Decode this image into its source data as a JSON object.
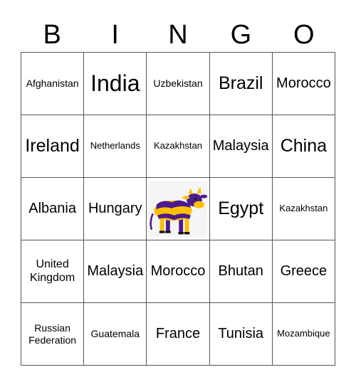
{
  "header": {
    "letters": [
      "B",
      "I",
      "N",
      "G",
      "O"
    ]
  },
  "grid": {
    "rows": [
      [
        {
          "text": "Afghanistan",
          "size": "s-xs"
        },
        {
          "text": "India",
          "size": "s-xl"
        },
        {
          "text": "Uzbekistan",
          "size": "s-xs"
        },
        {
          "text": "Brazil",
          "size": "s-l"
        },
        {
          "text": "Morocco",
          "size": "s-m"
        }
      ],
      [
        {
          "text": "Ireland",
          "size": "s-l"
        },
        {
          "text": "Netherlands",
          "size": "s-xxs"
        },
        {
          "text": "Kazakhstan",
          "size": "s-xxs"
        },
        {
          "text": "Malaysia",
          "size": "s-m"
        },
        {
          "text": "China",
          "size": "s-l"
        }
      ],
      [
        {
          "text": "Albania",
          "size": "s-m"
        },
        {
          "text": "Hungary",
          "size": "s-m"
        },
        {
          "text": "",
          "free": true,
          "icon": "cow-icon"
        },
        {
          "text": "Egypt",
          "size": "s-l"
        },
        {
          "text": "Kazakhstan",
          "size": "s-xxs"
        }
      ],
      [
        {
          "text": "United Kingdom",
          "size": "s-s"
        },
        {
          "text": "Malaysia",
          "size": "s-m"
        },
        {
          "text": "Morocco",
          "size": "s-m"
        },
        {
          "text": "Bhutan",
          "size": "s-m"
        },
        {
          "text": "Greece",
          "size": "s-m"
        }
      ],
      [
        {
          "text": "Russian Federation",
          "size": "s-xs"
        },
        {
          "text": "Guatemala",
          "size": "s-xs"
        },
        {
          "text": "France",
          "size": "s-m"
        },
        {
          "text": "Tunisia",
          "size": "s-m"
        },
        {
          "text": "Mozambique",
          "size": "s-xxs"
        }
      ]
    ]
  },
  "colors": {
    "cow_body": "#ffc000",
    "cow_spots": "#4b1a8c",
    "grid_line": "#555555"
  }
}
